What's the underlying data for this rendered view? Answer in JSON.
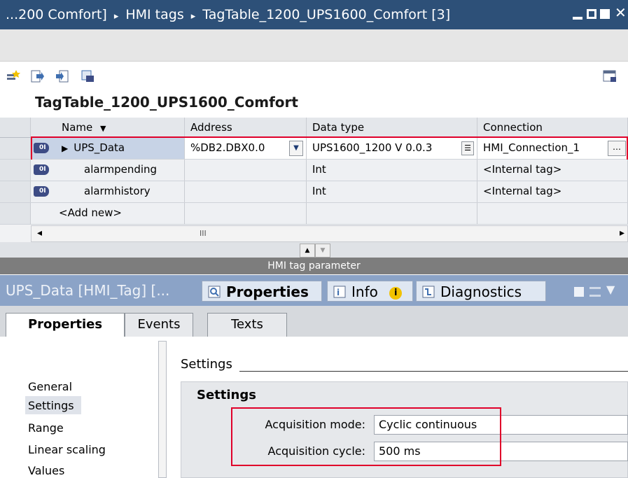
{
  "titlebar": {
    "crumb_1": "...200 Comfort]",
    "crumb_2": "HMI tags",
    "crumb_3": "TagTable_1200_UPS1600_Comfort [3]",
    "sep": "▸"
  },
  "table_title": "TagTable_1200_UPS1600_Comfort",
  "columns": {
    "name": "Name",
    "address": "Address",
    "data_type": "Data type",
    "connection": "Connection"
  },
  "rows": [
    {
      "name": "UPS_Data",
      "address": "%DB2.DBX0.0",
      "data_type": "UPS1600_1200 V 0.0.3",
      "connection": "HMI_Connection_1"
    },
    {
      "name": "alarmpending",
      "address": "",
      "data_type": "Int",
      "connection": "<Internal tag>"
    },
    {
      "name": "alarmhistory",
      "address": "",
      "data_type": "Int",
      "connection": "<Internal tag>"
    }
  ],
  "add_new": "<Add new>",
  "scroll_mid": "III",
  "param_header": "HMI tag parameter",
  "inspector": {
    "title": "UPS_Data [HMI_Tag] [...",
    "tab_properties": "Properties",
    "tab_info": "Info",
    "tab_diagnostics": "Diagnostics"
  },
  "subtabs": {
    "properties": "Properties",
    "events": "Events",
    "texts": "Texts"
  },
  "nav": [
    "General",
    "Settings",
    "Range",
    "Linear scaling",
    "Values"
  ],
  "settings": {
    "heading": "Settings",
    "subheading": "Settings",
    "acq_mode_label": "Acquisition mode:",
    "acq_mode_value": "Cyclic continuous",
    "acq_cycle_label": "Acquisition cycle:",
    "acq_cycle_value": "500 ms"
  },
  "colors": {
    "title_bar": "#2d5078",
    "inspector_bar": "#8ba3c7",
    "highlight_red": "#e0002a",
    "selected_row": "#c7d3e6"
  }
}
